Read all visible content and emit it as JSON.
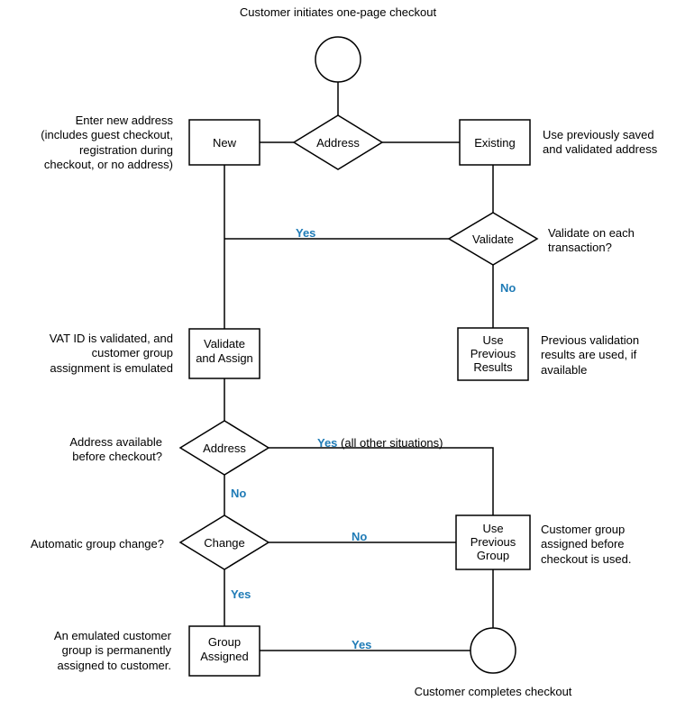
{
  "title": "Customer initiates one-page checkout",
  "nodes": {
    "start": "",
    "new": "New",
    "address1": "Address",
    "existing": "Existing",
    "validate": "Validate",
    "validateAssign": "Validate\nand Assign",
    "usePrevResults": "Use\nPrevious\nResults",
    "address2": "Address",
    "change": "Change",
    "usePrevGroup": "Use\nPrevious\nGroup",
    "groupAssigned": "Group\nAssigned",
    "end": ""
  },
  "captions": {
    "newCaption": "Enter new address\n(includes guest checkout,\nregistration during\ncheckout, or no address)",
    "existingCaption": "Use previously saved\nand validated address",
    "validateCaption": "Validate on each\ntransaction?",
    "validateAssignCaption": "VAT ID is validated, and\ncustomer group\nassignment is emulated",
    "usePrevResultsCaption": "Previous validation\nresults are used, if\navailable",
    "address2Caption": "Address available\nbefore checkout?",
    "changeCaption": "Automatic group change?",
    "usePrevGroupCaption": "Customer group\nassigned before\ncheckout is used.",
    "groupAssignedCaption": "An emulated customer\ngroup is permanently\nassigned to customer.",
    "endCaption": "Customer completes checkout"
  },
  "edgeLabels": {
    "validateYes": "Yes",
    "validateNo": "No",
    "address2Yes": "Yes",
    "address2YesExtra": "(all other situations)",
    "address2No": "No",
    "changeNo": "No",
    "changeYes": "Yes",
    "groupAssignedYes": "Yes"
  }
}
